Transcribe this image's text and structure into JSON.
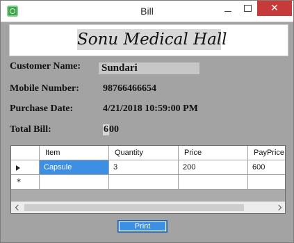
{
  "window": {
    "title": "Bill",
    "close_glyph": "✕",
    "icon": "app-icon"
  },
  "banner": {
    "shop_name": "Sonu Medical Hall"
  },
  "form": {
    "customer_name_label": "Customer Name:",
    "customer_name_value": "Sundari",
    "mobile_label": "Mobile Number:",
    "mobile_value": "98766466654",
    "purchase_date_label": "Purchase Date:",
    "purchase_date_value": "4/21/2018 10:59:00 PM",
    "total_bill_label": "Total Bill:",
    "total_bill_value_first": "6",
    "total_bill_value_rest": "00"
  },
  "grid": {
    "columns": [
      "Item",
      "Quantity",
      "Price",
      "PayPrice"
    ],
    "rows": [
      {
        "item": "Capsule",
        "quantity": "3",
        "price": "200",
        "payprice": "600"
      }
    ],
    "new_row_marker": "*"
  },
  "actions": {
    "print_label": "Print"
  },
  "colors": {
    "window_bg": "#a3a3a3",
    "selection": "#3c8fe3",
    "close_button": "#c73a3a"
  }
}
